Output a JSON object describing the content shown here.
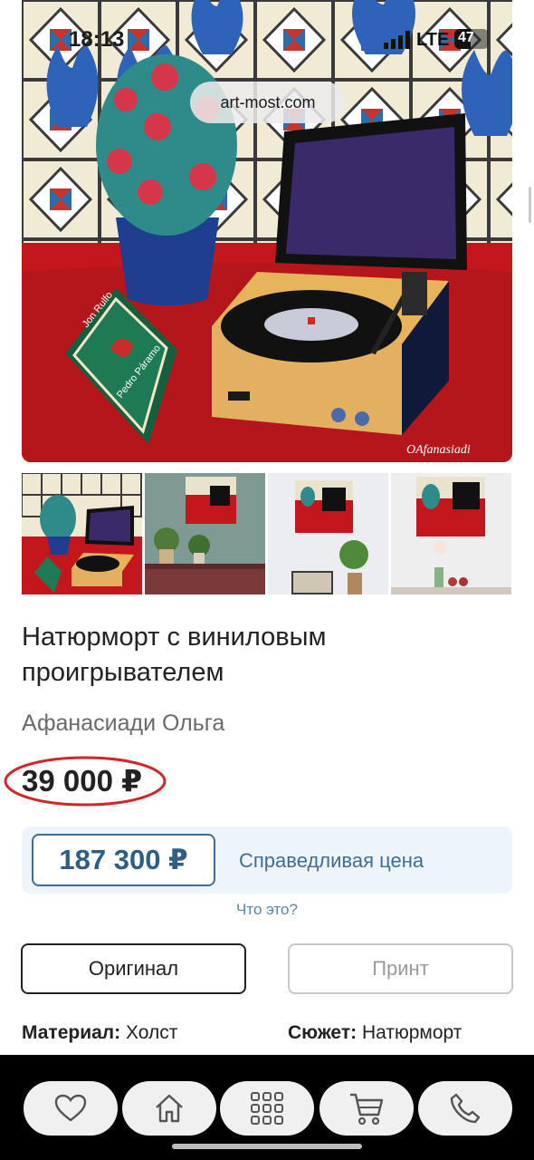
{
  "status_bar": {
    "time": "18:13",
    "network": "LTE",
    "battery": "47"
  },
  "url": "art-most.com",
  "artwork": {
    "signature": "OAfanasiadi",
    "book_text_1": "Jon Rulfo",
    "book_text_2": "Pedro Páramo"
  },
  "product": {
    "title": "Натюрморт с виниловым проигрывателем",
    "author": "Афанасиади Ольга",
    "price": "39 000 ₽"
  },
  "fair_price": {
    "value": "187 300 ₽",
    "label": "Справедливая цена",
    "help_link": "Что это?"
  },
  "options": {
    "original": "Оригинал",
    "print": "Принт"
  },
  "properties": {
    "material_label": "Материал:",
    "material_value": "Холст",
    "subject_label": "Сюжет:",
    "subject_value": "Натюрморт"
  },
  "tabbar": {
    "icons": [
      "heart-icon",
      "home-icon",
      "grid-icon",
      "cart-icon",
      "phone-icon"
    ]
  },
  "colors": {
    "accent": "#3d6e98",
    "price_circle": "#d0262b",
    "bar": "#000000"
  }
}
